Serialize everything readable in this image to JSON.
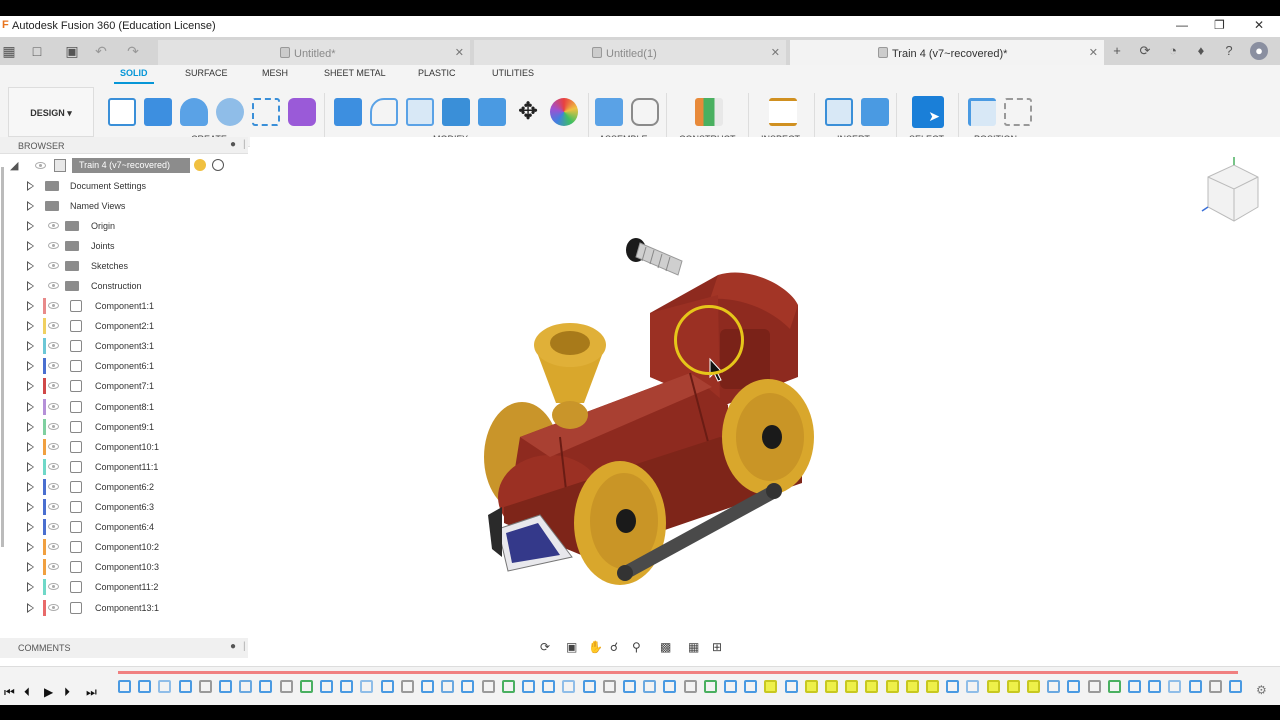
{
  "window": {
    "title": "Autodesk Fusion 360 (Education License)"
  },
  "tabs": [
    {
      "label": "Untitled*",
      "active": false
    },
    {
      "label": "Untitled(1)",
      "active": false
    },
    {
      "label": "Train 4 (v7~recovered)*",
      "active": true
    }
  ],
  "ribbon": {
    "workspace": "DESIGN",
    "tabs": [
      "SOLID",
      "SURFACE",
      "MESH",
      "SHEET METAL",
      "PLASTIC",
      "UTILITIES"
    ],
    "active_tab": "SOLID",
    "groups": [
      "CREATE",
      "MODIFY",
      "ASSEMBLE",
      "CONSTRUCT",
      "INSPECT",
      "INSERT",
      "SELECT",
      "POSITION"
    ]
  },
  "browser": {
    "header": "BROWSER",
    "root": "Train 4 (v7~recovered)",
    "folders": [
      "Document Settings",
      "Named Views",
      "Origin",
      "Joints",
      "Sketches",
      "Construction"
    ],
    "components": [
      {
        "label": "Component1:1",
        "color": "#e88a8a"
      },
      {
        "label": "Component2:1",
        "color": "#f0d060"
      },
      {
        "label": "Component3:1",
        "color": "#6cc7d6"
      },
      {
        "label": "Component6:1",
        "color": "#4a6fd0"
      },
      {
        "label": "Component7:1",
        "color": "#d04848"
      },
      {
        "label": "Component8:1",
        "color": "#b590d8"
      },
      {
        "label": "Component9:1",
        "color": "#7fd0a0"
      },
      {
        "label": "Component10:1",
        "color": "#f0a040"
      },
      {
        "label": "Component11:1",
        "color": "#70d8c8"
      },
      {
        "label": "Component6:2",
        "color": "#4a6fd0"
      },
      {
        "label": "Component6:3",
        "color": "#4a6fd0"
      },
      {
        "label": "Component6:4",
        "color": "#4a6fd0"
      },
      {
        "label": "Component10:2",
        "color": "#f0a040"
      },
      {
        "label": "Component10:3",
        "color": "#f0a040"
      },
      {
        "label": "Component11:2",
        "color": "#70d8c8"
      },
      {
        "label": "Component13:1",
        "color": "#e86a6a"
      }
    ]
  },
  "comments": {
    "label": "COMMENTS"
  },
  "colors": {
    "accent": "#0696d7",
    "model_body": "#8e2a1f",
    "model_gold": "#d9a72c",
    "highlight_ring": "#e6c61a"
  }
}
